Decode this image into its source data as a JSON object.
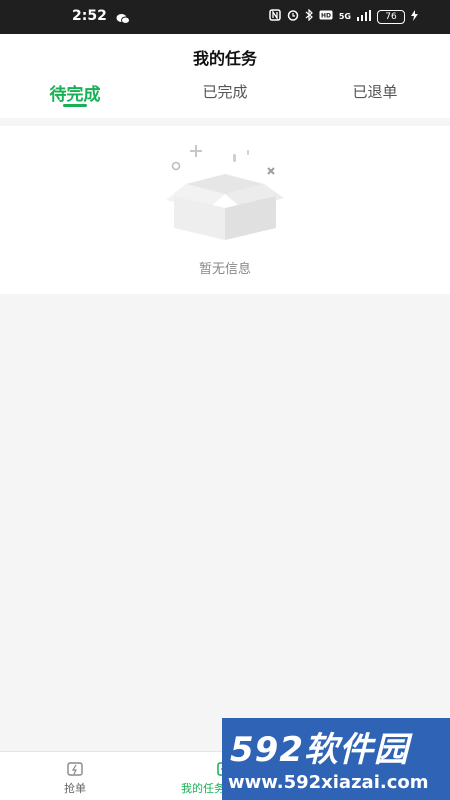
{
  "status_bar": {
    "time": "2:52",
    "network": "5G",
    "battery": "76"
  },
  "header": {
    "title": "我的任务"
  },
  "tabs": [
    {
      "label": "待完成",
      "active": true
    },
    {
      "label": "已完成",
      "active": false
    },
    {
      "label": "已退单",
      "active": false
    }
  ],
  "empty_state": {
    "message": "暂无信息",
    "icon": "empty-box-icon"
  },
  "bottom_nav": [
    {
      "label": "抢单",
      "icon": "lightning-icon",
      "active": false
    },
    {
      "label": "我的任务",
      "icon": "task-icon",
      "active": true
    }
  ],
  "watermark": {
    "top_text": "592软件园",
    "bottom_text": "www.592xiazai.com"
  },
  "colors": {
    "accent": "#17b054",
    "background": "#f5f5f5",
    "watermark_bg": "#2f63b5"
  }
}
